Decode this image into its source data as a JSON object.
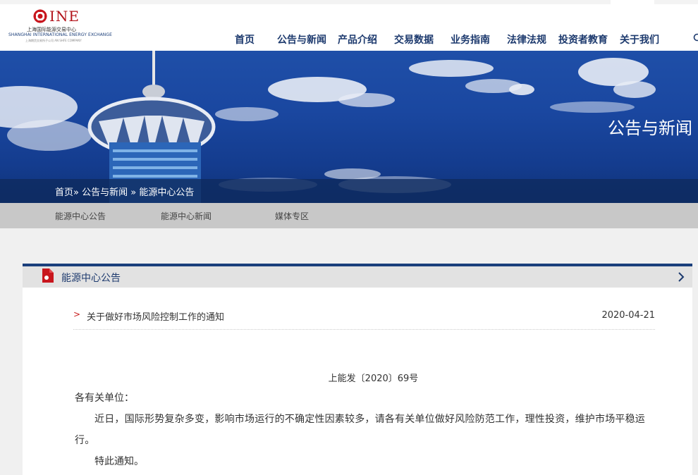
{
  "header": {
    "logo": {
      "brand": "INE",
      "name_cn": "上海国际能源交易中心",
      "name_en": "SHANGHAI INTERNATIONAL ENERGY EXCHANGE",
      "subtitle": "上海期货交易所子公司 AN SHFE COMPANY"
    },
    "nav": [
      {
        "label": "首页"
      },
      {
        "label": "公告与新闻"
      },
      {
        "label": "产品介绍"
      },
      {
        "label": "交易数据"
      },
      {
        "label": "业务指南"
      },
      {
        "label": "法律法规"
      },
      {
        "label": "投资者教育"
      },
      {
        "label": "关于我们"
      }
    ],
    "search_icon": "search-icon"
  },
  "banner": {
    "title": "公告与新闻",
    "breadcrumb": [
      "首页»",
      "公告与新闻",
      "»",
      "能源中心公告"
    ]
  },
  "subnav": [
    {
      "label": "能源中心公告"
    },
    {
      "label": "能源中心新闻"
    },
    {
      "label": "媒体专区"
    }
  ],
  "panel": {
    "title": "能源中心公告",
    "icon": "document-icon",
    "accent_color": "#1a3f7c",
    "article": {
      "marker": ">",
      "title": "关于做好市场风险控制工作的通知",
      "date": "2020-04-21",
      "doc_number": "上能发〔2020〕69号",
      "salutation": "各有关单位：",
      "body": "近日，国际形势复杂多变，影响市场运行的不确定性因素较多，请各有关单位做好风险防范工作，理性投资，维护市场平稳运行。",
      "closing": "特此通知。"
    }
  }
}
